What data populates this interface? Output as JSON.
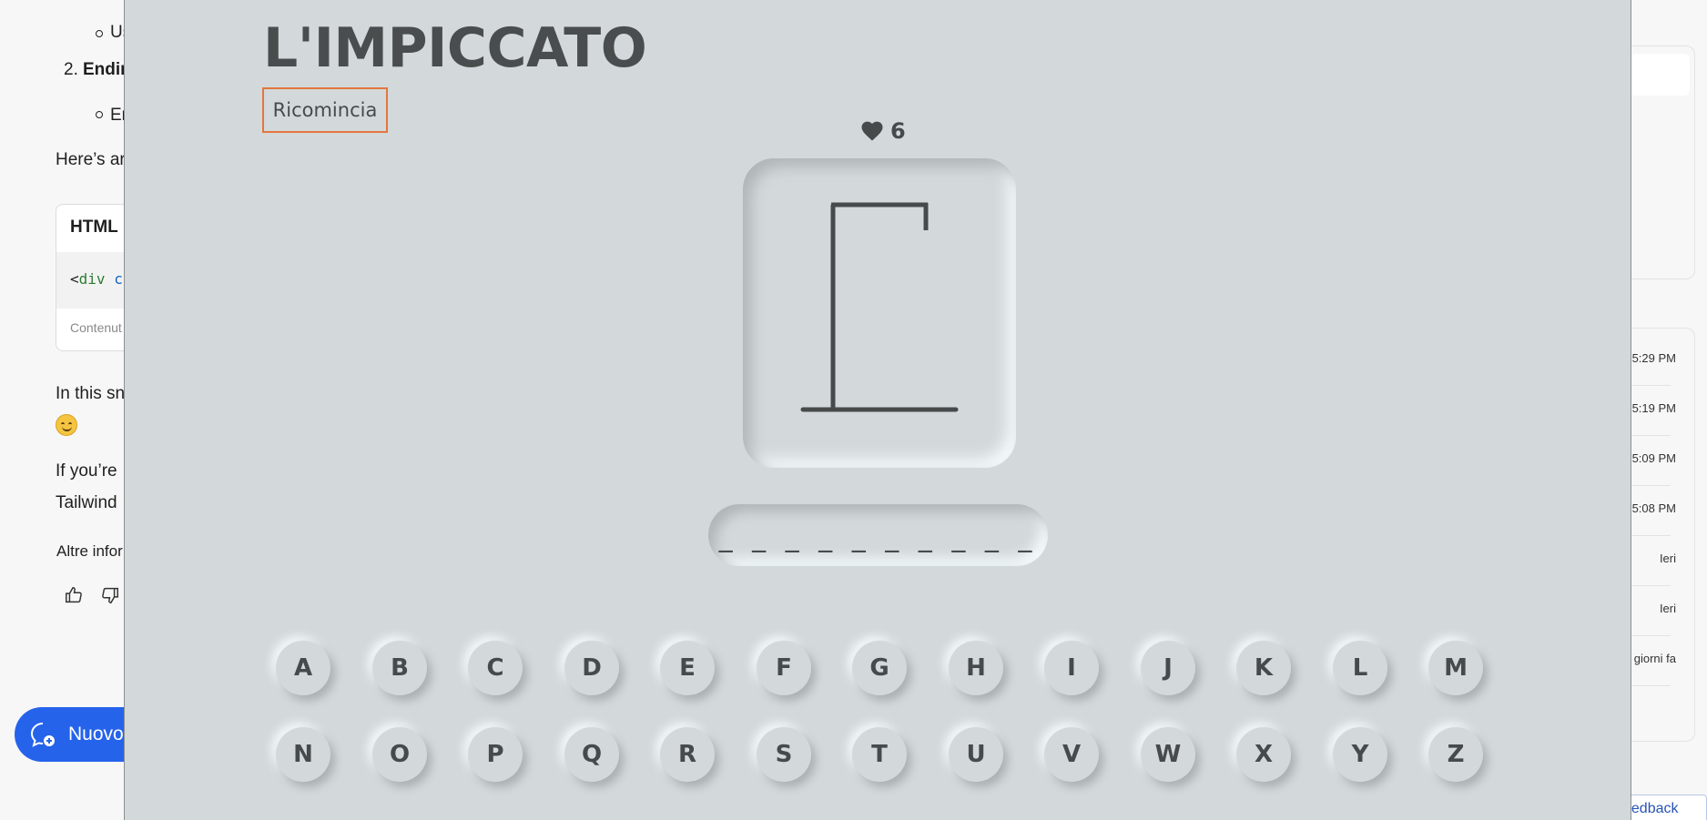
{
  "background_chat": {
    "list_fragment_1": "Us",
    "list_item_2_prefix": "2.",
    "list_item_2_fragment": "Endin",
    "list_fragment_2": "En",
    "para_fragment_1": "Here’s ar",
    "code_block": {
      "lang_label": "HTML",
      "code_open_bracket": "<",
      "code_tag": "div",
      "code_attr": "c",
      "footer_fragment": "Contenut"
    },
    "para_fragment_2": "In this sn",
    "para_fragment_3_line1": "If you’re",
    "para_fragment_3_line2": "Tailwind",
    "more_info_fragment": "Altre infor",
    "new_chat_label": "Nuovo"
  },
  "history_panel": {
    "times": [
      "5:29 PM",
      "5:19 PM",
      "5:09 PM",
      "5:08 PM",
      "Ieri",
      "Ieri",
      "giorni fa"
    ],
    "feedback_label": "eedback"
  },
  "game": {
    "title": "L'IMPICCATO",
    "restart_label": "Ricomincia",
    "lives": "6",
    "word_mask": "__________",
    "keys_row1": [
      "A",
      "B",
      "C",
      "D",
      "E",
      "F",
      "G",
      "H",
      "I",
      "J",
      "K",
      "L",
      "M"
    ],
    "keys_row2": [
      "N",
      "O",
      "P",
      "Q",
      "R",
      "S",
      "T",
      "U",
      "V",
      "W",
      "X",
      "Y",
      "Z"
    ]
  }
}
